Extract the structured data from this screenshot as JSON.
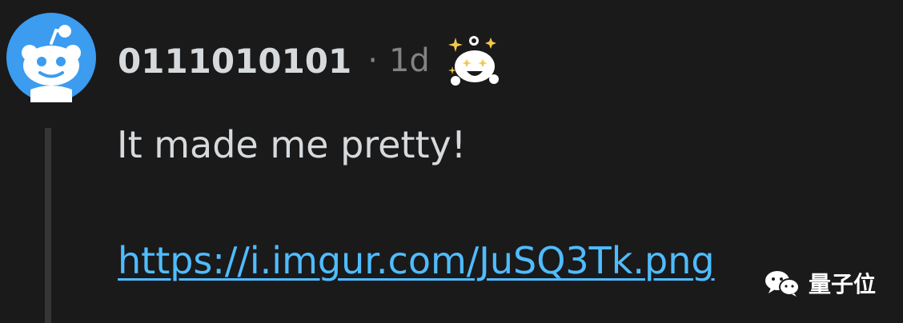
{
  "comment": {
    "author": "0111010101",
    "separator": "·",
    "age": "1d",
    "body": "It made me pretty!",
    "link": "https://i.imgur.com/JuSQ3Tk.png"
  },
  "watermark": {
    "text": "量子位"
  },
  "icons": {
    "avatar": "reddit-snoo-avatar-icon",
    "flair": "snoo-starstruck-flair-icon",
    "watermark": "wechat-logo-icon"
  },
  "colors": {
    "background": "#1a1a1b",
    "text": "#d7dadc",
    "meta": "#818384",
    "link": "#4fbcff",
    "avatar_bg": "#3b9cf0",
    "thread_line": "#343536"
  }
}
